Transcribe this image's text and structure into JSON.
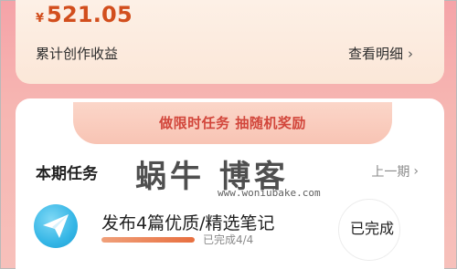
{
  "earnings": {
    "currency": "¥",
    "amount": "521.05",
    "label": "累计创作收益",
    "detail_link": "查看明细",
    "detail_chevron": "›"
  },
  "task_section": {
    "banner": "做限时任务 抽随机奖励",
    "title": "本期任务",
    "prev_link": "上一期",
    "prev_chevron": "›",
    "tasks": [
      {
        "icon": "paper-plane-icon",
        "name": "发布4篇优质/精选笔记",
        "progress_text": "已完成4/4",
        "progress": 1.0,
        "status": "已完成"
      }
    ]
  },
  "watermark": {
    "main": "蜗牛 博客",
    "sub": "www.woniubake.com"
  },
  "colors": {
    "accent": "#d24e1d",
    "banner_text": "#d2463b",
    "progress": "#e86f3f",
    "task_icon": "#35b6e6"
  }
}
